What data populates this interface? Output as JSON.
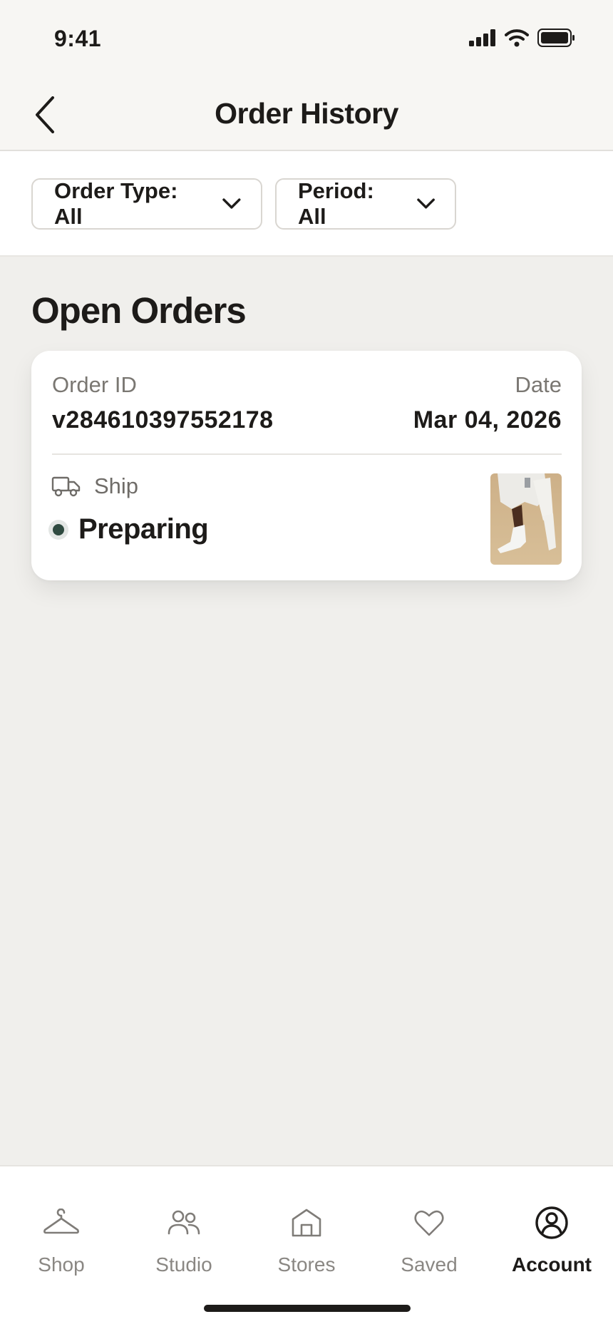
{
  "status_bar": {
    "time": "9:41"
  },
  "header": {
    "title": "Order History",
    "back_icon": "chevron-left-icon"
  },
  "filters": {
    "order_type": {
      "label": "Order Type: All",
      "icon": "chevron-down-icon"
    },
    "period": {
      "label": "Period: All",
      "icon": "chevron-down-icon"
    }
  },
  "section": {
    "title": "Open Orders"
  },
  "order": {
    "order_id_label": "Order ID",
    "order_id": "v284610397552178",
    "date_label": "Date",
    "date": "Mar 04, 2026",
    "ship_icon": "truck-icon",
    "ship_label": "Ship",
    "status": "Preparing",
    "status_color": "#2f4a40"
  },
  "tab_bar": {
    "active": "Account",
    "items": [
      {
        "label": "Shop",
        "icon": "hanger-icon"
      },
      {
        "label": "Studio",
        "icon": "people-icon"
      },
      {
        "label": "Stores",
        "icon": "store-icon"
      },
      {
        "label": "Saved",
        "icon": "heart-icon"
      },
      {
        "label": "Account",
        "icon": "account-icon"
      }
    ]
  }
}
